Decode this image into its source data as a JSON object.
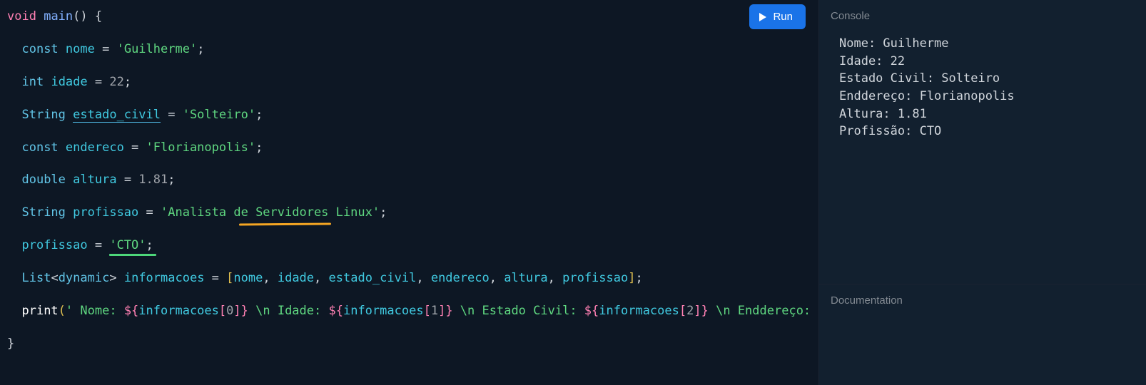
{
  "run_button_label": "Run",
  "code": {
    "l1_void": "void",
    "l1_fn": "main",
    "l1_rest": "() {",
    "l2_kw": "const",
    "l2_var": "nome",
    "l2_eq": " = ",
    "l2_str": "'Guilherme'",
    "l2_semi": ";",
    "l3_type": "int",
    "l3_var": "idade",
    "l3_eq": " = ",
    "l3_num": "22",
    "l3_semi": ";",
    "l4_type": "String",
    "l4_var": "estado_civil",
    "l4_eq": " = ",
    "l4_str": "'Solteiro'",
    "l4_semi": ";",
    "l5_kw": "const",
    "l5_var": "endereco",
    "l5_eq": " = ",
    "l5_str": "'Florianopolis'",
    "l5_semi": ";",
    "l6_type": "double",
    "l6_var": "altura",
    "l6_eq": " = ",
    "l6_num": "1.81",
    "l6_semi": ";",
    "l7_type": "String",
    "l7_var": "profissao",
    "l7_eq": " = ",
    "l7_str_pre": "'Analista ",
    "l7_str_mid": "de Servidores",
    "l7_str_post": " Linux'",
    "l7_semi": ";",
    "l8_var": "profissao",
    "l8_eq": " = ",
    "l8_str": "'CTO'",
    "l8_semi": ";",
    "l9_type": "List",
    "l9_generic_open": "<",
    "l9_generic_kw": "dynamic",
    "l9_generic_close": ">",
    "l9_var": "informacoes",
    "l9_eq": " = ",
    "l9_open": "[",
    "l9_v1": "nome",
    "l9_v2": "idade",
    "l9_v3": "estado_civil",
    "l9_v4": "endereco",
    "l9_v5": "altura",
    "l9_v6": "profissao",
    "l9_close": "]",
    "l9_semi": ";",
    "l10_fn": "print",
    "l10_open": "(",
    "l10_s1": "' Nome: ",
    "l10_i1a": "${",
    "l10_i1b": "informacoes",
    "l10_i1c": "[",
    "l10_i1d": "0",
    "l10_i1e": "]",
    "l10_i1f": "}",
    "l10_s2": " \\n Idade: ",
    "l10_i2d": "1",
    "l10_s3": " \\n Estado Civil: ",
    "l10_i3d": "2",
    "l10_s4": " \\n Enddereço:",
    "l11_close": "}"
  },
  "console": {
    "header": "Console",
    "line1": "Nome: Guilherme",
    "line2": "Idade: 22",
    "line3": "Estado Civil: Solteiro",
    "line4": "Enddereço: Florianopolis",
    "line5": "Altura: 1.81",
    "line6": "Profissão: CTO"
  },
  "documentation": {
    "header": "Documentation"
  }
}
